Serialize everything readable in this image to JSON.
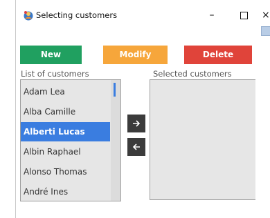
{
  "window": {
    "title": "Selecting customers",
    "controls": {
      "minimize": "–",
      "close": "×"
    }
  },
  "toolbar": {
    "new_label": "New",
    "modify_label": "Modify",
    "delete_label": "Delete"
  },
  "labels": {
    "list_of_customers": "List of customers",
    "selected_customers": "Selected customers"
  },
  "customers": {
    "items": [
      "Adam Lea",
      "Alba Camille",
      "Alberti Lucas",
      "Albin Raphael",
      "Alonso Thomas",
      "André Ines"
    ],
    "selected": "Alberti Lucas"
  },
  "transfer": {
    "add_icon": "arrow-right-icon",
    "remove_icon": "arrow-left-icon"
  },
  "selected_customers": [],
  "colors": {
    "new": "#20a060",
    "modify": "#f6a63b",
    "delete": "#e0443a",
    "selection": "#3a7de0",
    "list_background": "#e6e6e6",
    "arrow_button": "#3b3b3b"
  }
}
